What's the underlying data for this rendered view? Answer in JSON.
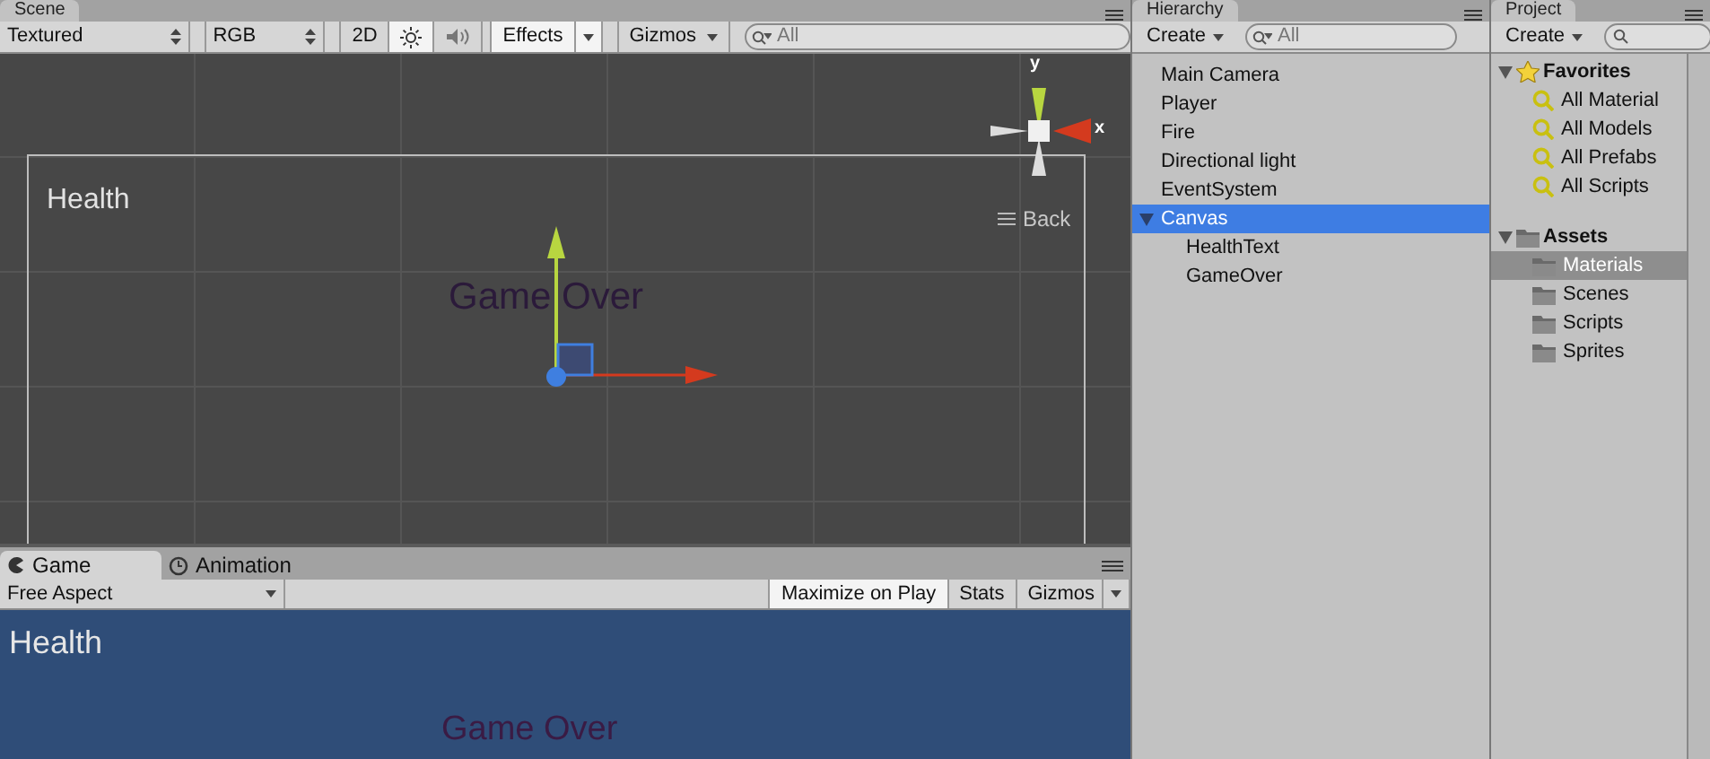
{
  "scene": {
    "tab": "Scene",
    "toolbar": {
      "shading": "Textured",
      "render_mode": "RGB",
      "mode_2d": {
        "label": "2D",
        "on": false
      },
      "lighting_on": true,
      "audio_on": false,
      "effects": {
        "label": "Effects",
        "on": true
      },
      "gizmos": "Gizmos",
      "search": {
        "placeholder": "All"
      }
    },
    "view": {
      "canvas_label": "Health",
      "game_over": "Game Over",
      "axis_y": "y",
      "axis_x": "x",
      "view_label": "Back"
    }
  },
  "hierarchy": {
    "tab": "Hierarchy",
    "create": "Create",
    "search": {
      "placeholder": "All"
    },
    "items": [
      {
        "label": "Main Camera",
        "selected": false
      },
      {
        "label": "Player",
        "selected": false
      },
      {
        "label": "Fire",
        "selected": false
      },
      {
        "label": "Directional light",
        "selected": false
      },
      {
        "label": "EventSystem",
        "selected": false
      },
      {
        "label": "Canvas",
        "selected": true,
        "expanded": true,
        "children": [
          {
            "label": "HealthText",
            "selected": false
          },
          {
            "label": "GameOver",
            "selected": false
          }
        ]
      }
    ]
  },
  "project": {
    "tab": "Project",
    "create": "Create",
    "favorites": {
      "label": "Favorites",
      "expanded": true,
      "items": [
        {
          "label": "All Material",
          "selected": false
        },
        {
          "label": "All Models",
          "selected": false
        },
        {
          "label": "All Prefabs",
          "selected": false
        },
        {
          "label": "All Scripts",
          "selected": false
        }
      ]
    },
    "assets": {
      "label": "Assets",
      "expanded": true,
      "items": [
        {
          "label": "Materials",
          "selected": true
        },
        {
          "label": "Scenes",
          "selected": false
        },
        {
          "label": "Scripts",
          "selected": false
        },
        {
          "label": "Sprites",
          "selected": false
        }
      ]
    }
  },
  "game": {
    "tabs": [
      {
        "label": "Game",
        "selected": true
      },
      {
        "label": "Animation",
        "selected": false
      }
    ],
    "toolbar": {
      "aspect": "Free Aspect",
      "maximize": {
        "label": "Maximize on Play",
        "on": true
      },
      "stats": "Stats",
      "gizmos": "Gizmos"
    },
    "view": {
      "health": "Health",
      "game_over": "Game Over"
    }
  }
}
